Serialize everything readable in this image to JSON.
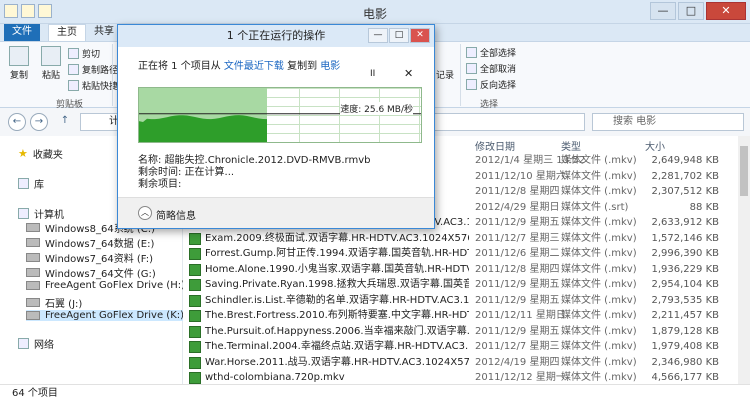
{
  "window": {
    "title": "电影",
    "close": "✕",
    "restore": "□",
    "minimize": "—"
  },
  "tabs": {
    "file": "文件",
    "home": "主页",
    "share": "共享"
  },
  "ribbon": {
    "copy": "复制",
    "paste": "粘贴",
    "cut": "剪切",
    "copy_path": "复制路径",
    "paste_shortcut": "粘贴快捷方式",
    "group_clipboard": "剪贴板",
    "select_all": "全部选择",
    "select_none": "全部取消",
    "invert_selection": "反向选择",
    "group_select": "选择",
    "history": "记录"
  },
  "address": {
    "path": "计",
    "search_placeholder": "搜索 电影"
  },
  "nav": {
    "favorites": "收藏夹",
    "library": "库",
    "computer": "计算机",
    "drives": [
      "Windows8_64系统 (C:)",
      "Windows7_64数据 (E:)",
      "Windows7_64资料 (F:)",
      "Windows7_64文件 (G:)",
      "FreeAgent GoFlex Drive (H:)",
      "石翼 (J:)",
      "FreeAgent GoFlex Drive (K:)"
    ],
    "network": "网络"
  },
  "columns": {
    "date": "修改日期",
    "type": "类型",
    "size": "大小"
  },
  "files": [
    {
      "name": "",
      "date": "2012/1/4 星期三 13:52",
      "type": "媒体文件 (.mkv)",
      "size": "2,649,948 KB"
    },
    {
      "name": "",
      "date": "2011/12/10 星期六",
      "type": "媒体文件 (.mkv)",
      "size": "2,281,702 KB"
    },
    {
      "name": "",
      "date": "2011/12/8 星期四",
      "type": "媒体文件 (.mkv)",
      "size": "2,307,512 KB"
    },
    {
      "name": "",
      "date": "2012/4/29 星期日",
      "type": "媒体文件 (.srt)",
      "size": "88 KB"
    },
    {
      "name": "Enemy.At.The.Gates.兵临城下.双语字幕.HR-HDTV.AC3.1024X576.x...",
      "date": "2011/12/9 星期五",
      "type": "媒体文件 (.mkv)",
      "size": "2,633,912 KB"
    },
    {
      "name": "Exam.2009.终极面试.双语字幕.HR-HDTV.AC3.1024X576.x264-人人...",
      "date": "2011/12/7 星期三",
      "type": "媒体文件 (.mkv)",
      "size": "1,572,146 KB"
    },
    {
      "name": "Forrest.Gump.阿甘正传.1994.双语字幕.国英音轨.HR-HDTV.AC3.1...",
      "date": "2011/12/6 星期二",
      "type": "媒体文件 (.mkv)",
      "size": "2,996,390 KB"
    },
    {
      "name": "Home.Alone.1990.小鬼当家.双语字幕.国英音轨.HR-HDTV.AC3.10...",
      "date": "2011/12/8 星期四",
      "type": "媒体文件 (.mkv)",
      "size": "1,936,229 KB"
    },
    {
      "name": "Saving.Private.Ryan.1998.拯救大兵瑞恩.双语字幕.国英音轨.HR-HD...",
      "date": "2011/12/9 星期五",
      "type": "媒体文件 (.mkv)",
      "size": "2,954,104 KB"
    },
    {
      "name": "Schindler.is.List.辛德勒的名单.双语字幕.HR-HDTV.AC3.1024X576...",
      "date": "2011/12/9 星期五",
      "type": "媒体文件 (.mkv)",
      "size": "2,793,535 KB"
    },
    {
      "name": "The.Brest.Fortress.2010.布列斯特要塞.中文字幕.HR-HDTV.AC3.10...",
      "date": "2011/12/11 星期日",
      "type": "媒体文件 (.mkv)",
      "size": "2,211,457 KB"
    },
    {
      "name": "The.Pursuit.of.Happyness.2006.当幸福来敲门.双语字幕.HR-HDTV.A...",
      "date": "2011/12/9 星期五",
      "type": "媒体文件 (.mkv)",
      "size": "1,879,128 KB"
    },
    {
      "name": "The.Terminal.2004.幸福终点站.双语字幕.HR-HDTV.AC3.1024X576.x...",
      "date": "2011/12/7 星期三",
      "type": "媒体文件 (.mkv)",
      "size": "1,979,408 KB"
    },
    {
      "name": "War.Horse.2011.战马.双语字幕.HR-HDTV.AC3.1024X576.x264-人人...",
      "date": "2012/4/19 星期四",
      "type": "媒体文件 (.mkv)",
      "size": "2,346,980 KB"
    },
    {
      "name": "wthd-colombiana.720p.mkv",
      "date": "2011/12/12 星期一",
      "type": "媒体文件 (.mkv)",
      "size": "4,566,177 KB"
    }
  ],
  "status": {
    "count": "64 个项目"
  },
  "dialog": {
    "title": "1 个正在运行的操作",
    "copy_prefix": "正在将 1 个项目从",
    "source": "文件最近下载",
    "copy_mid": "复制到",
    "dest": "电影",
    "speed": "速度: 25.6 MB/秒",
    "progress": 0.45,
    "name_line": "名称: 超能失控.Chronicle.2012.DVD-RMVB.rmvb",
    "time_line": "剩余时间: 正在计算...",
    "items_line": "剩余项目:",
    "more_info": "简略信息",
    "pause": "II",
    "cancel": "✕"
  },
  "colors": {
    "accent": "#1f6fb8",
    "graph_fill": "#a8d9a3",
    "graph_speed": "#2e9e2a"
  }
}
